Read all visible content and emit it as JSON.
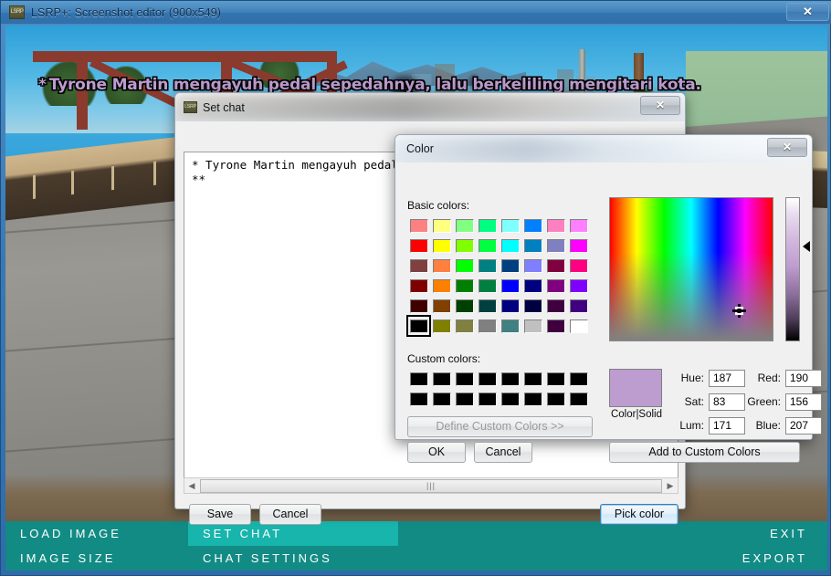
{
  "app": {
    "title": "LSRP+: Screenshot editor (900x549)",
    "icon": "lsrp-app-icon",
    "close_label": "✕"
  },
  "game_overlay": {
    "bullet": "*",
    "chat_line": "Tyrone Martin mengayuh pedal sepedahnya, lalu berkeliling mengitari kota.",
    "chat_color": "#bd9ccf"
  },
  "bottom_menu": {
    "left": [
      {
        "label": "LOAD IMAGE",
        "active": false
      },
      {
        "label": "IMAGE SIZE",
        "active": false
      }
    ],
    "middle": [
      {
        "label": "SET CHAT",
        "active": true
      },
      {
        "label": "CHAT SETTINGS",
        "active": false
      }
    ],
    "right": [
      {
        "label": "EXIT",
        "active": false
      },
      {
        "label": "EXPORT",
        "active": false
      }
    ],
    "bg_color": "#128b85",
    "active_color": "#17b5ab"
  },
  "setchat_dialog": {
    "title": "Set chat",
    "icon": "lsrp-app-icon",
    "close_label": "✕",
    "textarea_value": "* Tyrone Martin mengayuh pedal s\n**",
    "scrollbar": {
      "left_arrow": "◀",
      "right_arrow": "▶",
      "thumb_grip": "|||"
    },
    "buttons": {
      "save": "Save",
      "cancel": "Cancel",
      "pick_color": "Pick color"
    }
  },
  "color_dialog": {
    "title": "Color",
    "close_label": "✕",
    "basic_colors_label": "Basic colors:",
    "custom_colors_label": "Custom colors:",
    "define_custom_label": "Define Custom Colors >>",
    "ok_label": "OK",
    "cancel_label": "Cancel",
    "add_custom_label": "Add to Custom Colors",
    "preview_label": "Color|Solid",
    "preview_color": "#bd9ccf",
    "fields": {
      "hue_label": "Hue:",
      "hue_value": "187",
      "sat_label": "Sat:",
      "sat_value": "83",
      "lum_label": "Lum:",
      "lum_value": "171",
      "red_label": "Red:",
      "red_value": "190",
      "green_label": "Green:",
      "green_value": "156",
      "blue_label": "Blue:",
      "blue_value": "207"
    },
    "basic_colors": [
      "#ff8080",
      "#ffff80",
      "#80ff80",
      "#00ff80",
      "#80ffff",
      "#0080ff",
      "#ff80c0",
      "#ff80ff",
      "#ff0000",
      "#ffff00",
      "#80ff00",
      "#00ff40",
      "#00ffff",
      "#0080c0",
      "#8080c0",
      "#ff00ff",
      "#804040",
      "#ff8040",
      "#00ff00",
      "#008080",
      "#004080",
      "#8080ff",
      "#800040",
      "#ff0080",
      "#800000",
      "#ff8000",
      "#008000",
      "#008040",
      "#0000ff",
      "#000080",
      "#800080",
      "#8000ff",
      "#400000",
      "#804000",
      "#004000",
      "#004040",
      "#000080",
      "#000040",
      "#400040",
      "#400080",
      "#000000",
      "#808000",
      "#808040",
      "#808080",
      "#408080",
      "#c0c0c0",
      "#400040",
      "#ffffff"
    ],
    "selected_basic_index": 40,
    "custom_colors": [
      "#000000",
      "#000000",
      "#000000",
      "#000000",
      "#000000",
      "#000000",
      "#000000",
      "#000000",
      "#000000",
      "#000000",
      "#000000",
      "#000000",
      "#000000",
      "#000000",
      "#000000",
      "#000000"
    ]
  }
}
